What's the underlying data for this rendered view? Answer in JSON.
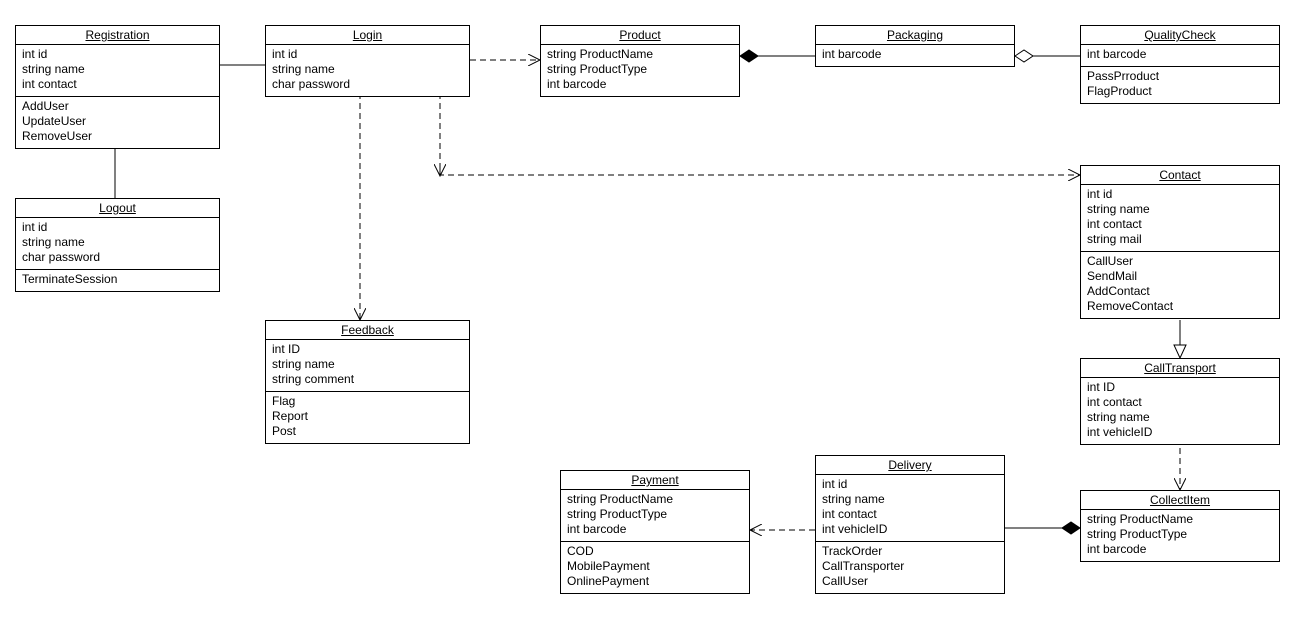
{
  "classes": {
    "registration": {
      "title": "Registration",
      "attrs": [
        "int id",
        "string name",
        "int contact"
      ],
      "ops": [
        "AddUser",
        "UpdateUser",
        "RemoveUser"
      ]
    },
    "login": {
      "title": "Login",
      "attrs": [
        "int id",
        "string name",
        "char password"
      ],
      "ops": []
    },
    "product": {
      "title": "Product",
      "attrs": [
        "string ProductName",
        "string ProductType",
        "int barcode"
      ],
      "ops": []
    },
    "packaging": {
      "title": "Packaging",
      "attrs": [
        "int barcode"
      ],
      "ops": []
    },
    "qualitycheck": {
      "title": "QualityCheck",
      "attrs": [
        "int barcode"
      ],
      "ops": [
        "PassPrroduct",
        "FlagProduct"
      ]
    },
    "logout": {
      "title": "Logout",
      "attrs": [
        "int id",
        "string name",
        "char password"
      ],
      "ops": [
        "TerminateSession"
      ]
    },
    "contact": {
      "title": "Contact",
      "attrs": [
        "int id",
        "string name",
        "int contact",
        "string mail"
      ],
      "ops": [
        "CallUser",
        "SendMail",
        "AddContact",
        "RemoveContact"
      ]
    },
    "feedback": {
      "title": "Feedback",
      "attrs": [
        "int ID",
        "string name",
        "string comment"
      ],
      "ops": [
        "Flag",
        "Report",
        "Post"
      ]
    },
    "calltransport": {
      "title": "CallTransport",
      "attrs": [
        "int ID",
        "int contact",
        "string name",
        "int vehicleID"
      ],
      "ops": []
    },
    "payment": {
      "title": "Payment",
      "attrs": [
        "string ProductName",
        "string ProductType",
        "int barcode"
      ],
      "ops": [
        "COD",
        "MobilePayment",
        "OnlinePayment"
      ]
    },
    "delivery": {
      "title": "Delivery",
      "attrs": [
        "int id",
        "string name",
        "int contact",
        "int vehicleID"
      ],
      "ops": [
        "TrackOrder",
        "CallTransporter",
        "CallUser"
      ]
    },
    "collectitem": {
      "title": "CollectItem",
      "attrs": [
        "string ProductName",
        "string ProductType",
        "int barcode"
      ],
      "ops": []
    }
  },
  "edges": [
    {
      "id": "reg-login",
      "kind": "association",
      "dashed": false,
      "from": "registration",
      "to": "login"
    },
    {
      "id": "reg-logout",
      "kind": "association",
      "dashed": false,
      "from": "registration",
      "to": "logout"
    },
    {
      "id": "login-product",
      "kind": "dependency",
      "dashed": true,
      "from": "login",
      "to": "product"
    },
    {
      "id": "login-feedback",
      "kind": "dependency",
      "dashed": true,
      "from": "login",
      "to": "feedback"
    },
    {
      "id": "login-contact",
      "kind": "dependency",
      "dashed": true,
      "from": "login",
      "to": "contact"
    },
    {
      "id": "prod-pack",
      "kind": "composition",
      "dashed": false,
      "from": "packaging",
      "to": "product"
    },
    {
      "id": "pack-qc",
      "kind": "aggregation",
      "dashed": false,
      "from": "qualitycheck",
      "to": "packaging"
    },
    {
      "id": "contact-ct",
      "kind": "realization",
      "dashed": false,
      "from": "contact",
      "to": "calltransport"
    },
    {
      "id": "ct-collect",
      "kind": "dependency",
      "dashed": true,
      "from": "calltransport",
      "to": "collectitem"
    },
    {
      "id": "collect-deliv",
      "kind": "composition",
      "dashed": false,
      "from": "collectitem",
      "to": "delivery"
    },
    {
      "id": "deliv-pay",
      "kind": "dependency",
      "dashed": true,
      "from": "delivery",
      "to": "payment"
    }
  ]
}
